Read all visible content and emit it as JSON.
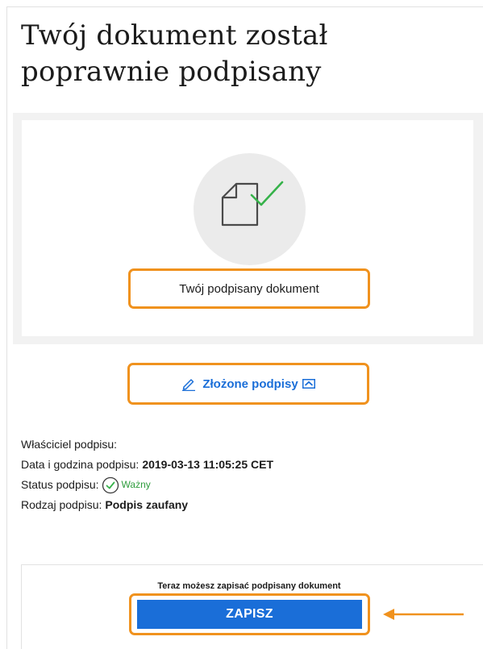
{
  "page": {
    "title": "Twój dokument został poprawnie podpisany"
  },
  "document": {
    "icon": "signed-document-icon",
    "link_label": "Twój podpisany dokument"
  },
  "signatures": {
    "icon": "pencil-icon",
    "label": "Złożone podpisy",
    "toggle_icon": "chevron-up-icon"
  },
  "signature_info": {
    "owner_label": "Właściciel podpisu:",
    "owner_value": "",
    "date_label": "Data i godzina podpisu:",
    "date_value": "2019-03-13 11:05:25 CET",
    "status_label": "Status podpisu:",
    "status_icon": "check-circle-icon",
    "status_value": "Ważny",
    "type_label": "Rodzaj podpisu:",
    "type_value": "Podpis zaufany"
  },
  "save": {
    "hint": "Teraz możesz zapisać podpisany dokument",
    "button_label": "ZAPISZ"
  },
  "colors": {
    "accent_blue": "#1a6ed8",
    "highlight_orange": "#f0921e",
    "success_green": "#2e9c3c",
    "check_green": "#36b24a"
  }
}
